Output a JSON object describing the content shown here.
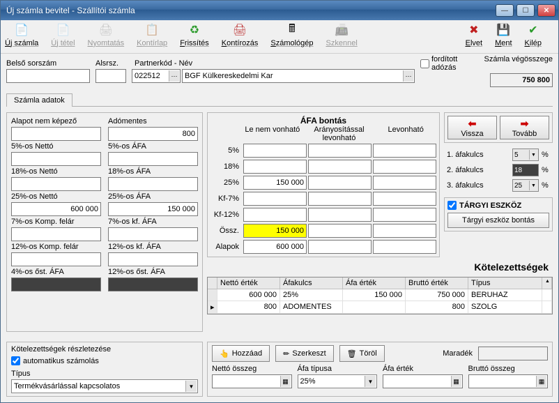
{
  "window": {
    "title": "Új számla bevitel - Szállítói számla"
  },
  "toolbar": [
    {
      "name": "uj-szamla",
      "label": "Új számla",
      "icon": "📄",
      "enabled": true
    },
    {
      "name": "uj-tetel",
      "label": "Új tétel",
      "icon": "📄",
      "enabled": false
    },
    {
      "name": "nyomtatas",
      "label": "Nyomtatás",
      "icon": "🖨",
      "enabled": false
    },
    {
      "name": "kontirlap",
      "label": "Kontírlap",
      "icon": "📋",
      "enabled": false
    },
    {
      "name": "frissites",
      "label": "Frissítés",
      "icon": "♻",
      "enabled": true,
      "color": "#2a9a2a"
    },
    {
      "name": "kontirozas",
      "label": "Kontírozás",
      "icon": "🖨",
      "enabled": true,
      "color": "#c04040"
    },
    {
      "name": "szamologep",
      "label": "Számológép",
      "icon": "🖩",
      "enabled": true
    },
    {
      "name": "szkennel",
      "label": "Szkennel",
      "icon": "📠",
      "enabled": false
    },
    {
      "name": "elvet",
      "label": "Elvet",
      "icon": "✖",
      "enabled": true,
      "color": "#c02020"
    },
    {
      "name": "ment",
      "label": "Ment",
      "icon": "💾",
      "enabled": true
    },
    {
      "name": "kilep",
      "label": "Kilép",
      "icon": "✔",
      "enabled": true,
      "color": "#2a9a2a"
    }
  ],
  "header": {
    "label_belso": "Belső sorszám",
    "label_alsrsz": "Alsrsz.",
    "label_partner": "Partnerkód - Név",
    "label_fordadozas": "fordított adózás",
    "label_vegosszeg": "Számla végösszege",
    "belso": "",
    "alsrsz": "",
    "partnerkod": "022512",
    "partner_nev": "BGF Külkereskedelmi Kar",
    "vegosszeg": "750 800"
  },
  "tab": "Számla adatok",
  "left": {
    "labels": {
      "alapot": "Alapot nem képező",
      "adomentes": "Adómentes",
      "netto5": "5%-os Nettó",
      "afa5": "5%-os ÁFA",
      "netto18": "18%-os Nettó",
      "afa18": "18%-os ÁFA",
      "netto25": "25%-os Nettó",
      "afa25": "25%-os ÁFA",
      "komp7": "7%-os Komp. felár",
      "kfafa7": "7%-os kf. ÁFA",
      "komp12": "12%-os Komp. felár",
      "kfafa12": "12%-os kf. ÁFA",
      "ost4": "4%-os őst. ÁFA",
      "ost12": "12%-os őst. ÁFA"
    },
    "values": {
      "alapot": "",
      "adomentes": "800",
      "netto5": "",
      "afa5": "",
      "netto18": "",
      "afa18": "",
      "netto25": "600 000",
      "afa25": "150 000",
      "komp7": "",
      "kfafa7": "",
      "komp12": "",
      "kfafa12": ""
    }
  },
  "afa": {
    "title": "ÁFA bontás",
    "col1": "Le nem vonható",
    "col2": "Arányosítással levonható",
    "col3": "Levonható",
    "rows": [
      "5%",
      "18%",
      "25%",
      "Kf-7%",
      "Kf-12%",
      "Össz.",
      "Alapok"
    ],
    "v25_c1": "150 000",
    "ossz_c1": "150 000",
    "alapok_c1": "600 000"
  },
  "right": {
    "vissza": "Vissza",
    "tovabb": "Tovább",
    "k1": "1. áfakulcs",
    "k1v": "5",
    "k2": "2. áfakulcs",
    "k2v": "18",
    "k3": "3. áfakulcs",
    "k3v": "25",
    "targyi": "TÁRGYI ESZKÖZ",
    "targyi_btn": "Tárgyi eszköz bontás"
  },
  "kotel": {
    "title": "Kötelezettségek",
    "headers": [
      "Nettó érték",
      "Áfakulcs",
      "Áfa érték",
      "Bruttó érték",
      "Típus"
    ],
    "rows": [
      {
        "netto": "600 000",
        "kulcs": "25%",
        "afa": "150 000",
        "brutto": "750 000",
        "tipus": "BERUHAZ"
      },
      {
        "netto": "800",
        "kulcs": "ADOMENTES",
        "afa": "",
        "brutto": "800",
        "tipus": "SZOLG"
      }
    ]
  },
  "bottom": {
    "section_title": "Kötelezettségek részletezése",
    "auto": "automatikus számolás",
    "tipus_label": "Típus",
    "tipus_value": "Termékvásárlással kapcsolatos",
    "hozzaad": "Hozzáad",
    "szerkeszt": "Szerkeszt",
    "torol": "Töröl",
    "maradek": "Maradék",
    "netto_label": "Nettó összeg",
    "afatipus_label": "Áfa típusa",
    "afatipus_value": "25%",
    "afaertek_label": "Áfa érték",
    "brutto_label": "Bruttó összeg"
  }
}
